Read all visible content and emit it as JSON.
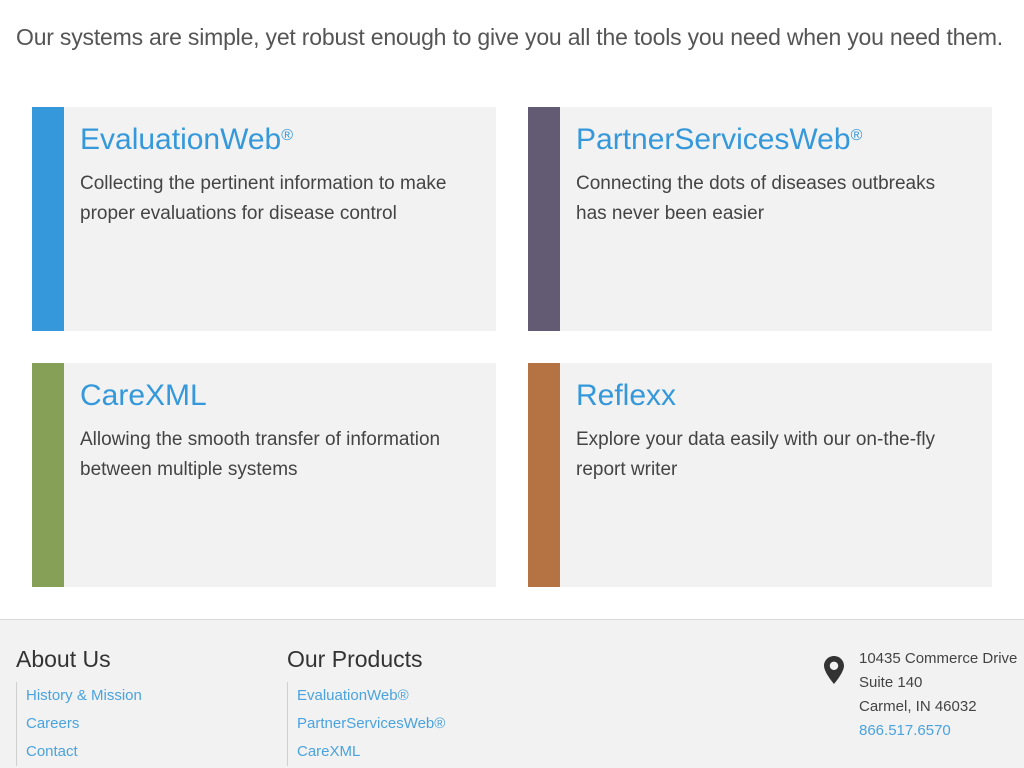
{
  "intro": "Our systems are simple, yet robust enough to give you all the tools you need when you need them.",
  "products": [
    {
      "name": "EvaluationWeb",
      "trademark": "®",
      "description": "Collecting the pertinent information to make proper evaluations for disease control",
      "accent_color": "#3498db"
    },
    {
      "name": "PartnerServicesWeb",
      "trademark": "®",
      "description": "Connecting the dots of diseases outbreaks has never been easier",
      "accent_color": "#635a73"
    },
    {
      "name": "CareXML",
      "trademark": "",
      "description": "Allowing the smooth transfer of information between multiple systems",
      "accent_color": "#86a058"
    },
    {
      "name": "Reflexx",
      "trademark": "",
      "description": "Explore your data easily with our on-the-fly report writer",
      "accent_color": "#b57343"
    }
  ],
  "footer": {
    "about": {
      "heading": "About Us",
      "links": [
        "History & Mission",
        "Careers",
        "Contact"
      ]
    },
    "products": {
      "heading": "Our Products",
      "links": [
        "EvaluationWeb®",
        "PartnerServicesWeb®",
        "CareXML"
      ]
    },
    "address": {
      "icon": "map-pin-icon",
      "line1": "10435 Commerce Drive",
      "line2": "Suite 140",
      "line3": "Carmel, IN 46032",
      "phone": "866.517.6570"
    }
  }
}
